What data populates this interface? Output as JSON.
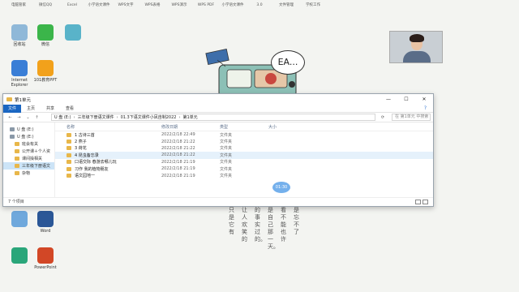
{
  "desktop": {
    "top_labels": [
      "电脑管家",
      "微信QQ",
      "Excel",
      "小学语文课件",
      "WPS文字",
      "WPS表格",
      "WPS演示",
      "WPS PDF",
      "小学语文课件",
      "3.0",
      "文件管理",
      "学校工作"
    ],
    "icons": [
      {
        "label": "回收站",
        "color": "#8fb8d8"
      },
      {
        "label": "微信",
        "color": "#3bb54a"
      },
      {
        "label": "",
        "color": "#59b3c9"
      },
      {
        "label": "Internet Explorer",
        "color": "#3a7ed6"
      },
      {
        "label": "101教育PPT",
        "color": "#f2a11b"
      },
      {
        "label": "",
        "color": "#6fa8dc"
      },
      {
        "label": "Word",
        "color": "#2b5797"
      },
      {
        "label": "",
        "color": "#2aa67a"
      },
      {
        "label": "PowerPoint",
        "color": "#d24726"
      }
    ],
    "bubble_text": "EA...",
    "poem_columns": [
      "只是它有",
      "让人欢笑的",
      "的事实过的。",
      "是自己那一天。",
      "看不能也许",
      "是忘不了"
    ]
  },
  "window": {
    "title": "第1单元",
    "ribbon": {
      "file": "文件",
      "home": "主页",
      "share": "共享",
      "view": "查看"
    },
    "controls": {
      "min": "—",
      "max": "☐",
      "close": "✕"
    },
    "nav": {
      "back": "←",
      "forward": "→",
      "up": "↑"
    },
    "address": [
      "U 盘 (E:)",
      "三年级下册语文课件",
      "01.3下语文课件小凤自制2022",
      "第1单元"
    ],
    "search_placeholder": "在 第1单元 中搜索",
    "sidebar": [
      {
        "label": "U 盘 (E:)",
        "kind": "drive",
        "indent": false,
        "selected": false
      },
      {
        "label": "U 盘 (E:)",
        "kind": "drive",
        "indent": false,
        "selected": false
      },
      {
        "label": "班会有关",
        "kind": "folder",
        "indent": true,
        "selected": false
      },
      {
        "label": "公开课＋个人资",
        "kind": "folder",
        "indent": true,
        "selected": false
      },
      {
        "label": "课间操相关",
        "kind": "folder",
        "indent": true,
        "selected": false
      },
      {
        "label": "三年级下册语文",
        "kind": "folder",
        "indent": true,
        "selected": true
      },
      {
        "label": "杂物",
        "kind": "folder",
        "indent": true,
        "selected": false
      }
    ],
    "columns": {
      "name": "名称",
      "date": "修改日期",
      "type": "类型",
      "size": "大小"
    },
    "rows": [
      {
        "name": "1 古诗三首",
        "date": "2022/2/18 22:49",
        "type": "文件夹"
      },
      {
        "name": "2 燕子",
        "date": "2022/2/18 21:22",
        "type": "文件夹"
      },
      {
        "name": "3 荷花",
        "date": "2022/2/18 21:22",
        "type": "文件夹"
      },
      {
        "name": "4 昆虫备忘录",
        "date": "2022/2/18 21:22",
        "type": "文件夹"
      },
      {
        "name": "口语交际 春游去哪儿玩",
        "date": "2022/2/18 21:19",
        "type": "文件夹"
      },
      {
        "name": "习作 我的植物朋友",
        "date": "2022/2/18 21:19",
        "type": "文件夹"
      },
      {
        "name": "语文园地一",
        "date": "2022/2/18 21:19",
        "type": "文件夹"
      }
    ],
    "overlay_bubble": "01:30",
    "status": "7 个项目"
  }
}
